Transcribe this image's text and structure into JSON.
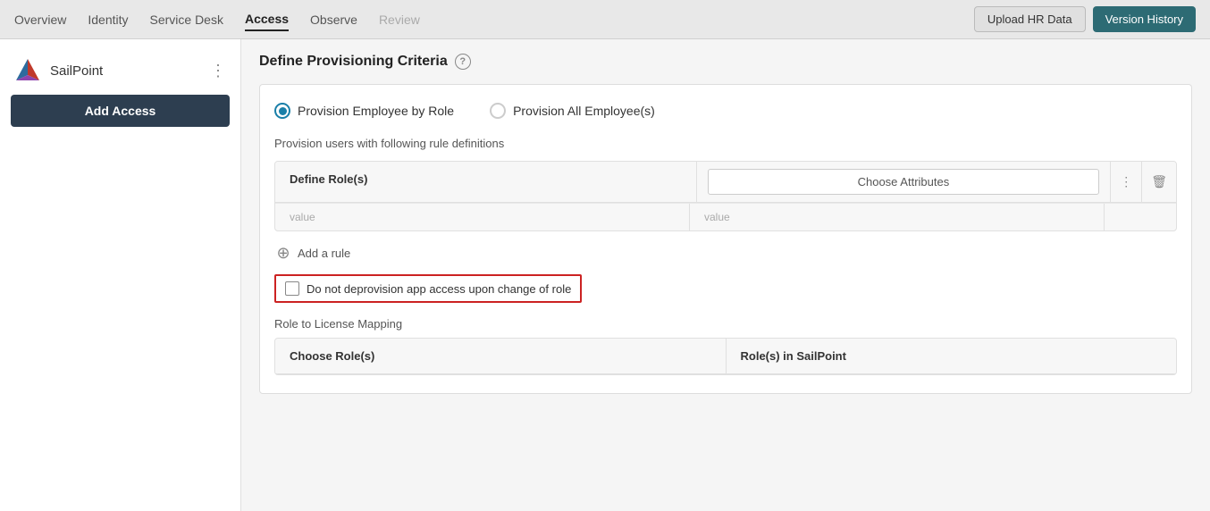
{
  "nav": {
    "items": [
      {
        "id": "overview",
        "label": "Overview",
        "state": "normal"
      },
      {
        "id": "identity",
        "label": "Identity",
        "state": "normal"
      },
      {
        "id": "service-desk",
        "label": "Service Desk",
        "state": "normal"
      },
      {
        "id": "access",
        "label": "Access",
        "state": "active"
      },
      {
        "id": "observe",
        "label": "Observe",
        "state": "normal"
      },
      {
        "id": "review",
        "label": "Review",
        "state": "disabled"
      }
    ],
    "upload_hr_label": "Upload HR Data",
    "version_history_label": "Version History"
  },
  "sidebar": {
    "brand_name": "SailPoint",
    "add_access_label": "Add Access"
  },
  "main": {
    "section_title": "Define Provisioning Criteria",
    "help_icon": "?",
    "radio_options": [
      {
        "id": "by-role",
        "label": "Provision Employee by Role",
        "selected": true
      },
      {
        "id": "all-employees",
        "label": "Provision All Employee(s)",
        "selected": false
      }
    ],
    "provision_description": "Provision users with following rule definitions",
    "table": {
      "col_role_label": "Define Role(s)",
      "col_attrs_label": "Choose Attributes",
      "choose_attrs_btn_label": "Choose Attributes",
      "more_icon": "⋮",
      "delete_icon": "🗑",
      "value_placeholder": "value"
    },
    "add_rule_label": "Add a rule",
    "add_rule_icon": "⊕",
    "checkbox": {
      "label": "Do not deprovision app access upon change of role",
      "checked": false
    },
    "mapping_section": {
      "title": "Role to License Mapping",
      "col_choose_roles": "Choose Role(s)",
      "col_sailpoint_roles": "Role(s) in SailPoint"
    }
  }
}
